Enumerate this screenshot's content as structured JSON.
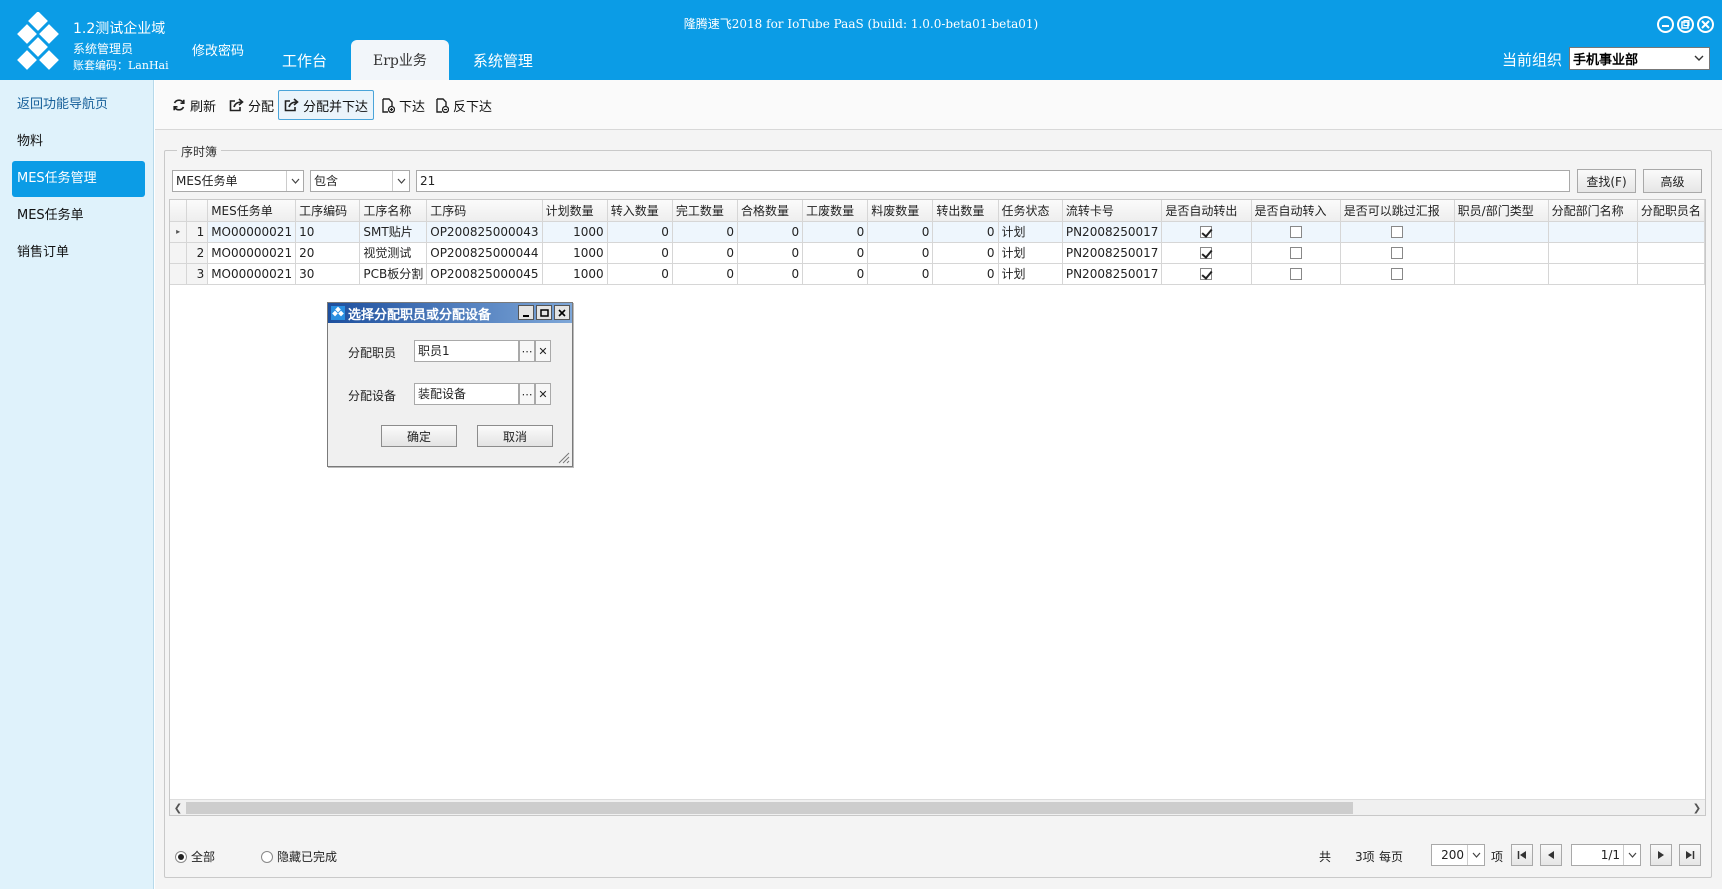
{
  "header": {
    "org": "1.2测试企业域",
    "role": "系统管理员",
    "account": "账套编码：LanHai",
    "change_password": "修改密码",
    "app_title": "隆腾速飞2018 for IoTube PaaS (build: 1.0.0-beta01-beta01)",
    "tabs": [
      "工作台",
      "Erp业务",
      "系统管理"
    ],
    "active_tab": "Erp业务",
    "org_label": "当前组织",
    "org_select": "手机事业部",
    "brand_color": "#0b9ce6"
  },
  "sidebar": {
    "items": [
      "返回功能导航页",
      "物料",
      "MES任务管理",
      "MES任务单",
      "销售订单"
    ],
    "active": "MES任务管理"
  },
  "toolbar": {
    "refresh": "刷新",
    "assign": "分配",
    "assign_release": "分配并下达",
    "release": "下达",
    "unrelease": "反下达"
  },
  "panel": {
    "legend": "序时簿"
  },
  "filter": {
    "field": "MES任务单",
    "op": "包含",
    "value": "21",
    "find": "查找(F)",
    "advanced": "高级"
  },
  "table": {
    "columns": [
      "MES任务单",
      "工序编码",
      "工序名称",
      "工序码",
      "计划数量",
      "转入数量",
      "完工数量",
      "合格数量",
      "工废数量",
      "料废数量",
      "转出数量",
      "任务状态",
      "流转卡号",
      "是否自动转出",
      "是否自动转入",
      "是否可以跳过汇报",
      "职员/部门类型",
      "分配部门名称",
      "分配职员名"
    ],
    "rows": [
      {
        "no": "1",
        "task": "MO00000021",
        "op_code": "10",
        "op_name": "SMT贴片",
        "op_no": "OP200825000043",
        "plan": "1000",
        "in": "0",
        "done": "0",
        "ok": "0",
        "wf": "0",
        "lf": "0",
        "out": "0",
        "status": "计划",
        "card": "PN2008250017",
        "auto_out": true,
        "auto_in": false,
        "skip": false
      },
      {
        "no": "2",
        "task": "MO00000021",
        "op_code": "20",
        "op_name": "视觉测试",
        "op_no": "OP200825000044",
        "plan": "1000",
        "in": "0",
        "done": "0",
        "ok": "0",
        "wf": "0",
        "lf": "0",
        "out": "0",
        "status": "计划",
        "card": "PN2008250017",
        "auto_out": true,
        "auto_in": false,
        "skip": false
      },
      {
        "no": "3",
        "task": "MO00000021",
        "op_code": "30",
        "op_name": "PCB板分割",
        "op_no": "OP200825000045",
        "plan": "1000",
        "in": "0",
        "done": "0",
        "ok": "0",
        "wf": "0",
        "lf": "0",
        "out": "0",
        "status": "计划",
        "card": "PN2008250017",
        "auto_out": true,
        "auto_in": false,
        "skip": false
      }
    ]
  },
  "footer": {
    "all": "全部",
    "hide_done": "隐藏已完成",
    "total_prefix": "共",
    "total_count": "3项",
    "per_page_label": "每页",
    "page_size": "200",
    "page_size_unit": "项",
    "page": "1/1"
  },
  "dialog": {
    "title": "选择分配职员或分配设备",
    "staff_label": "分配职员",
    "staff_value": "职员1",
    "device_label": "分配设备",
    "device_value": "装配设备",
    "ok": "确定",
    "cancel": "取消"
  }
}
